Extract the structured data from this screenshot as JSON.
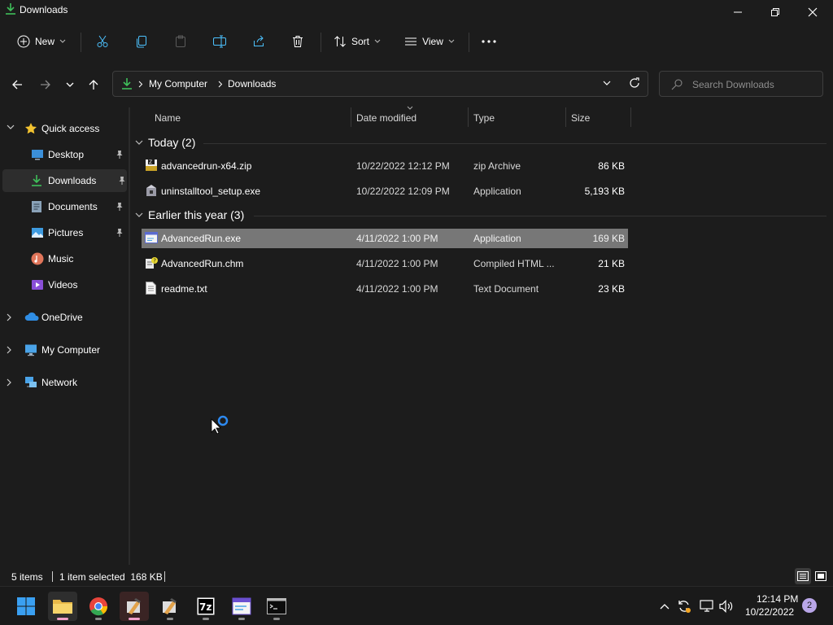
{
  "window": {
    "title": "Downloads"
  },
  "command_bar": {
    "new_label": "New",
    "sort_label": "Sort",
    "view_label": "View"
  },
  "address": {
    "crumbs": [
      "My Computer",
      "Downloads"
    ]
  },
  "search": {
    "placeholder": "Search Downloads"
  },
  "nav_pane": {
    "quick_access": "Quick access",
    "items": [
      {
        "label": "Desktop",
        "icon": "desktop-icon",
        "pinned": true
      },
      {
        "label": "Downloads",
        "icon": "download-icon",
        "pinned": true,
        "selected": true
      },
      {
        "label": "Documents",
        "icon": "documents-icon",
        "pinned": true
      },
      {
        "label": "Pictures",
        "icon": "pictures-icon",
        "pinned": true
      },
      {
        "label": "Music",
        "icon": "music-icon",
        "pinned": false
      },
      {
        "label": "Videos",
        "icon": "videos-icon",
        "pinned": false
      }
    ],
    "roots": [
      "OneDrive",
      "My Computer",
      "Network"
    ]
  },
  "file_list": {
    "columns": {
      "name": "Name",
      "date": "Date modified",
      "type": "Type",
      "size": "Size"
    },
    "groups": [
      {
        "label": "Today (2)",
        "files": [
          {
            "name": "advancedrun-x64.zip",
            "date": "10/22/2022 12:12 PM",
            "type": "zip Archive",
            "size": "86 KB",
            "icon": "zip-icon"
          },
          {
            "name": "uninstalltool_setup.exe",
            "date": "10/22/2022 12:09 PM",
            "type": "Application",
            "size": "5,193 KB",
            "icon": "installer-icon"
          }
        ]
      },
      {
        "label": "Earlier this year (3)",
        "files": [
          {
            "name": "AdvancedRun.exe",
            "date": "4/11/2022 1:00 PM",
            "type": "Application",
            "size": "169 KB",
            "icon": "app-window-icon",
            "selected": true
          },
          {
            "name": "AdvancedRun.chm",
            "date": "4/11/2022 1:00 PM",
            "type": "Compiled HTML ...",
            "size": "21 KB",
            "icon": "chm-help-icon"
          },
          {
            "name": "readme.txt",
            "date": "4/11/2022 1:00 PM",
            "type": "Text Document",
            "size": "23 KB",
            "icon": "text-file-icon"
          }
        ]
      }
    ]
  },
  "status": {
    "items": "5 items",
    "selection": "1 item selected  168 KB"
  },
  "taskbar": {
    "apps": [
      "start-icon",
      "file-explorer-icon",
      "chrome-icon",
      "advancedrun-icon",
      "advancedrun-icon",
      "7zip-icon",
      "window-app-icon",
      "terminal-icon"
    ],
    "time": "12:14 PM",
    "date": "10/22/2022",
    "notifications": "2"
  },
  "colors": {
    "accent": "#4cc2ff",
    "selection": "#777777",
    "background": "#1c1c1c"
  }
}
